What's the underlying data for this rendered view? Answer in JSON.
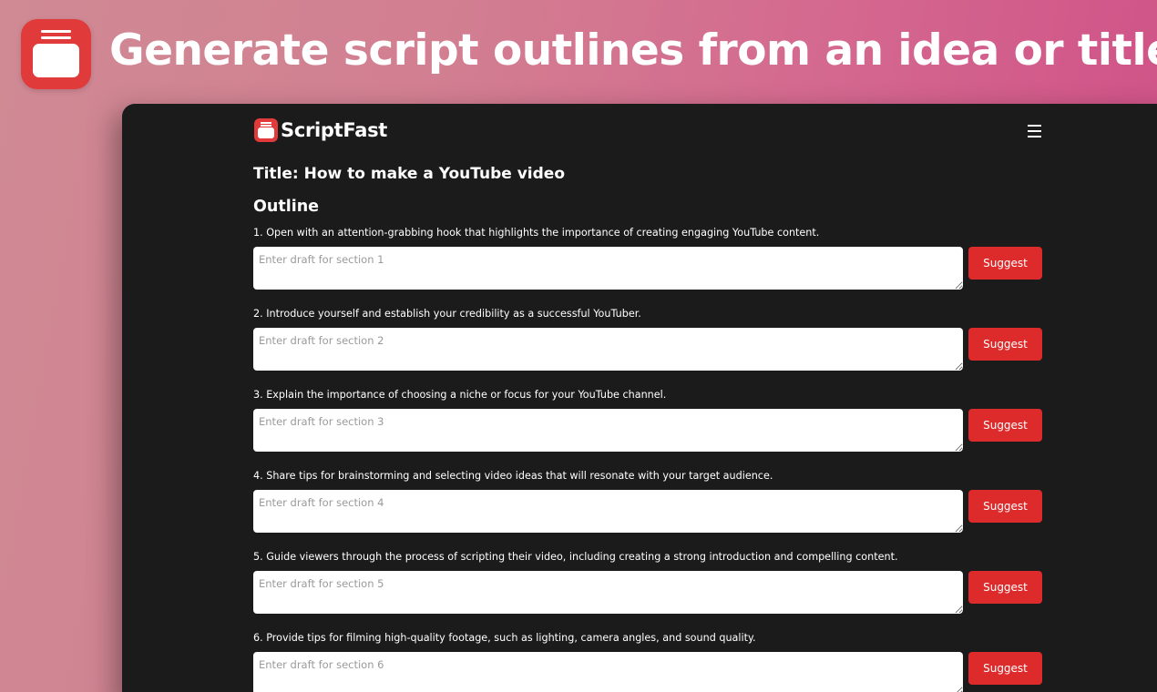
{
  "hero": {
    "title": "Generate script outlines from an idea or title",
    "icon": "scriptfast-app-icon"
  },
  "app": {
    "brand_name": "ScriptFast",
    "menu_icon": "hamburger-menu-icon",
    "doc_title": "Title: How to make a YouTube video",
    "outline_heading": "Outline"
  },
  "sections": [
    {
      "label": "1. Open with an attention-grabbing hook that highlights the importance of creating engaging YouTube content.",
      "placeholder": "Enter draft for section 1",
      "value": "",
      "button_label": "Suggest"
    },
    {
      "label": "2. Introduce yourself and establish your credibility as a successful YouTuber.",
      "placeholder": "Enter draft for section 2",
      "value": "",
      "button_label": "Suggest"
    },
    {
      "label": "3. Explain the importance of choosing a niche or focus for your YouTube channel.",
      "placeholder": "Enter draft for section 3",
      "value": "",
      "button_label": "Suggest"
    },
    {
      "label": "4. Share tips for brainstorming and selecting video ideas that will resonate with your target audience.",
      "placeholder": "Enter draft for section 4",
      "value": "",
      "button_label": "Suggest"
    },
    {
      "label": "5. Guide viewers through the process of scripting their video, including creating a strong introduction and compelling content.",
      "placeholder": "Enter draft for section 5",
      "value": "",
      "button_label": "Suggest"
    },
    {
      "label": "6. Provide tips for filming high-quality footage, such as lighting, camera angles, and sound quality.",
      "placeholder": "Enter draft for section 6",
      "value": "",
      "button_label": "Suggest"
    }
  ],
  "colors": {
    "accent": "#dd2a2a",
    "window_background": "#1b1b1b",
    "background_gradient": [
      "#cf8a94",
      "#cf4e86"
    ]
  }
}
